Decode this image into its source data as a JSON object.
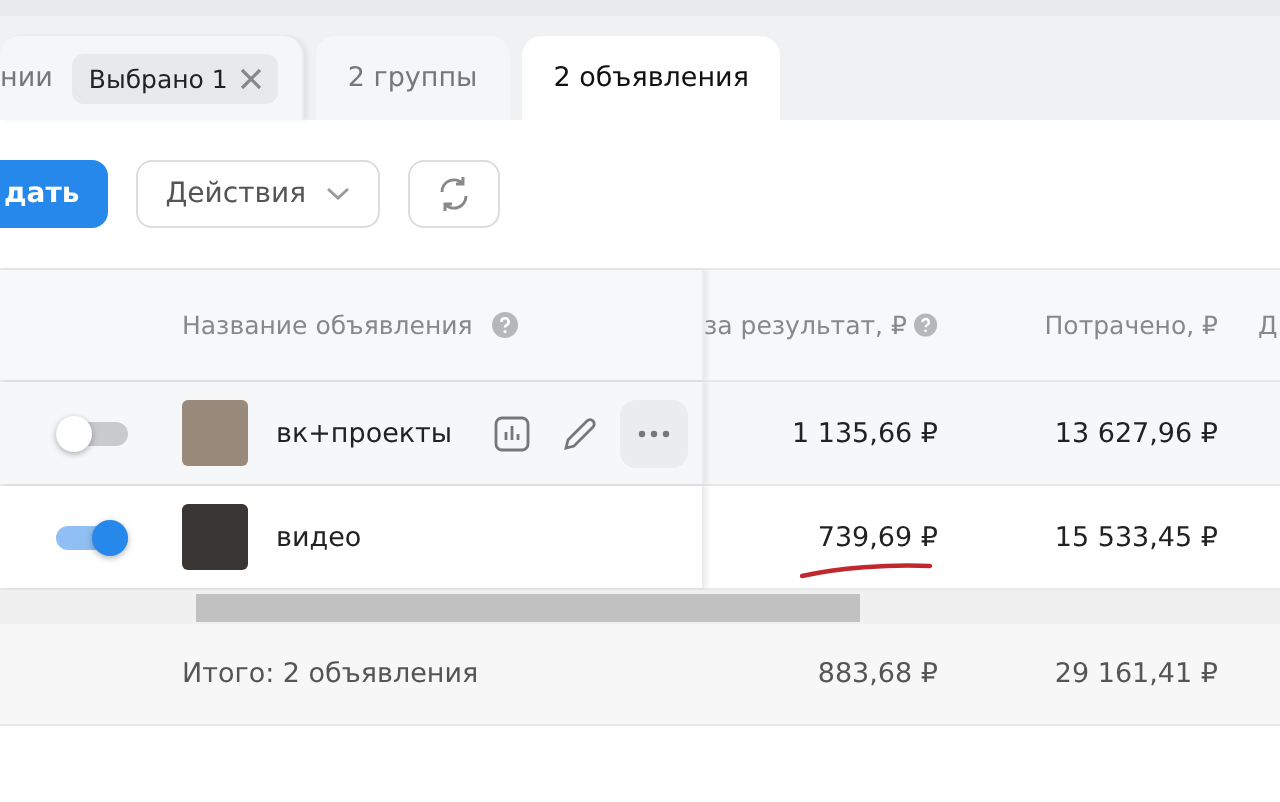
{
  "tabs": [
    {
      "label": "нии",
      "selected": false,
      "chip": "Выбрано 1"
    },
    {
      "label": "2 группы",
      "selected": false
    },
    {
      "label": "2 объявления",
      "selected": true
    }
  ],
  "toolbar": {
    "create_button": "дать",
    "actions_button": "Действия"
  },
  "table": {
    "columns": [
      {
        "label": "Название объявления",
        "help": true
      },
      {
        "label": "за результат, ₽",
        "help": true
      },
      {
        "label": "Потрачено, ₽",
        "help": false
      },
      {
        "label": "Д",
        "help": false
      }
    ],
    "rows": [
      {
        "on": false,
        "name": "вк+проекты",
        "hovered": true,
        "result": "1 135,66 ₽",
        "spent": "13 627,96 ₽",
        "underlined": false
      },
      {
        "on": true,
        "name": "видео",
        "hovered": false,
        "result": "739,69 ₽",
        "spent": "15 533,45 ₽",
        "underlined": true
      }
    ],
    "footer": {
      "label": "Итого: 2 объявления",
      "result": "883,68 ₽",
      "spent": "29 161,41 ₽"
    }
  }
}
